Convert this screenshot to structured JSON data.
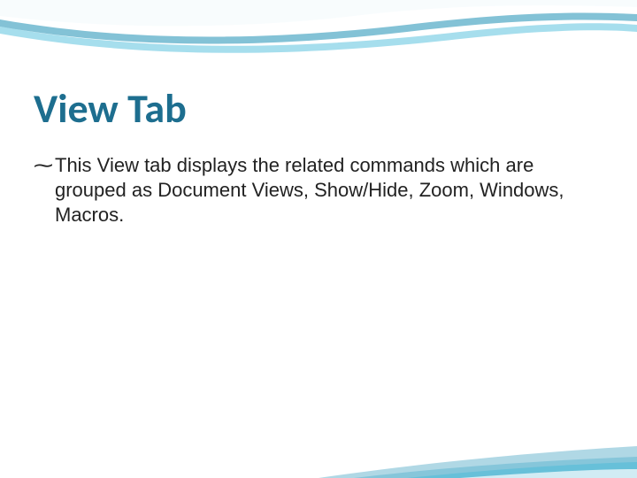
{
  "slide": {
    "title": "View Tab",
    "bullet_glyph": "ؐ",
    "body": "This View tab displays the related commands which are grouped as Document Views, Show/Hide, Zoom, Windows, Macros."
  }
}
